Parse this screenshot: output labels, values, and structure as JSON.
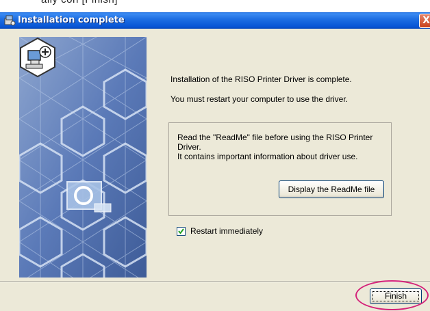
{
  "caption_fragment": "ally con   [Finish]",
  "window": {
    "title": "Installation complete",
    "close_label": "X",
    "icon": "installer-icon"
  },
  "messages": {
    "line1": "Installation of the RISO Printer Driver is complete.",
    "line2": "You must restart your computer to use the driver."
  },
  "readme_group": {
    "line1": "Read the \"ReadMe\" file before using the RISO Printer",
    "line2": "Driver.",
    "line3": "It contains important information about driver use.",
    "button_label": "Display the ReadMe file"
  },
  "restart": {
    "label": "Restart immediately",
    "checked": true
  },
  "finish_button": {
    "label": "Finish",
    "highlight_color": "#d4237a"
  },
  "colors": {
    "titlebar": "#0855d5",
    "dialog_bg": "#ece9d8",
    "panel_bg": "#4a6aa8"
  }
}
